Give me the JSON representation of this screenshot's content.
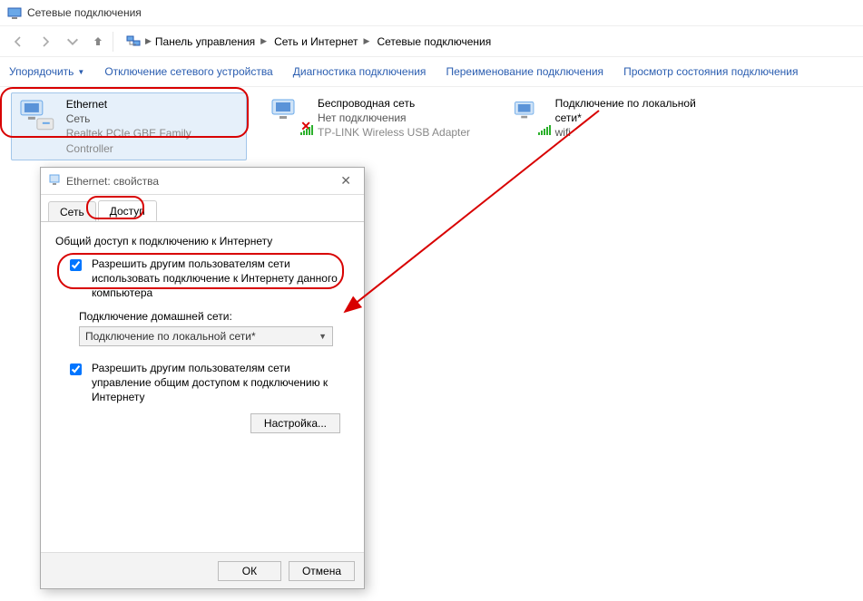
{
  "window": {
    "title": "Сетевые подключения"
  },
  "breadcrumb": {
    "seg1": "Панель управления",
    "seg2": "Сеть и Интернет",
    "seg3": "Сетевые подключения"
  },
  "toolbar": {
    "organize": "Упорядочить",
    "disable": "Отключение сетевого устройства",
    "diagnose": "Диагностика подключения",
    "rename": "Переименование подключения",
    "status": "Просмотр состояния подключения"
  },
  "connections": [
    {
      "name": "Ethernet",
      "status": "Сеть",
      "device": "Realtek PCIe GBE Family Controller"
    },
    {
      "name": "Беспроводная сеть",
      "status": "Нет подключения",
      "device": "TP-LINK Wireless USB Adapter"
    },
    {
      "name": "Подключение по локальной сети*",
      "status": "wifi",
      "device": ""
    }
  ],
  "dialog": {
    "title": "Ethernet: свойства",
    "tabs": {
      "net": "Сеть",
      "access": "Доступ"
    },
    "group_title": "Общий доступ к подключению к Интернету",
    "chk1": "Разрешить другим пользователям сети использовать подключение к Интернету данного компьютера",
    "home_label": "Подключение домашней сети:",
    "combo_value": "Подключение по локальной сети*",
    "chk2": "Разрешить другим пользователям сети управление общим доступом к подключению к Интернету",
    "settings_btn": "Настройка...",
    "ok": "ОК",
    "cancel": "Отмена"
  }
}
